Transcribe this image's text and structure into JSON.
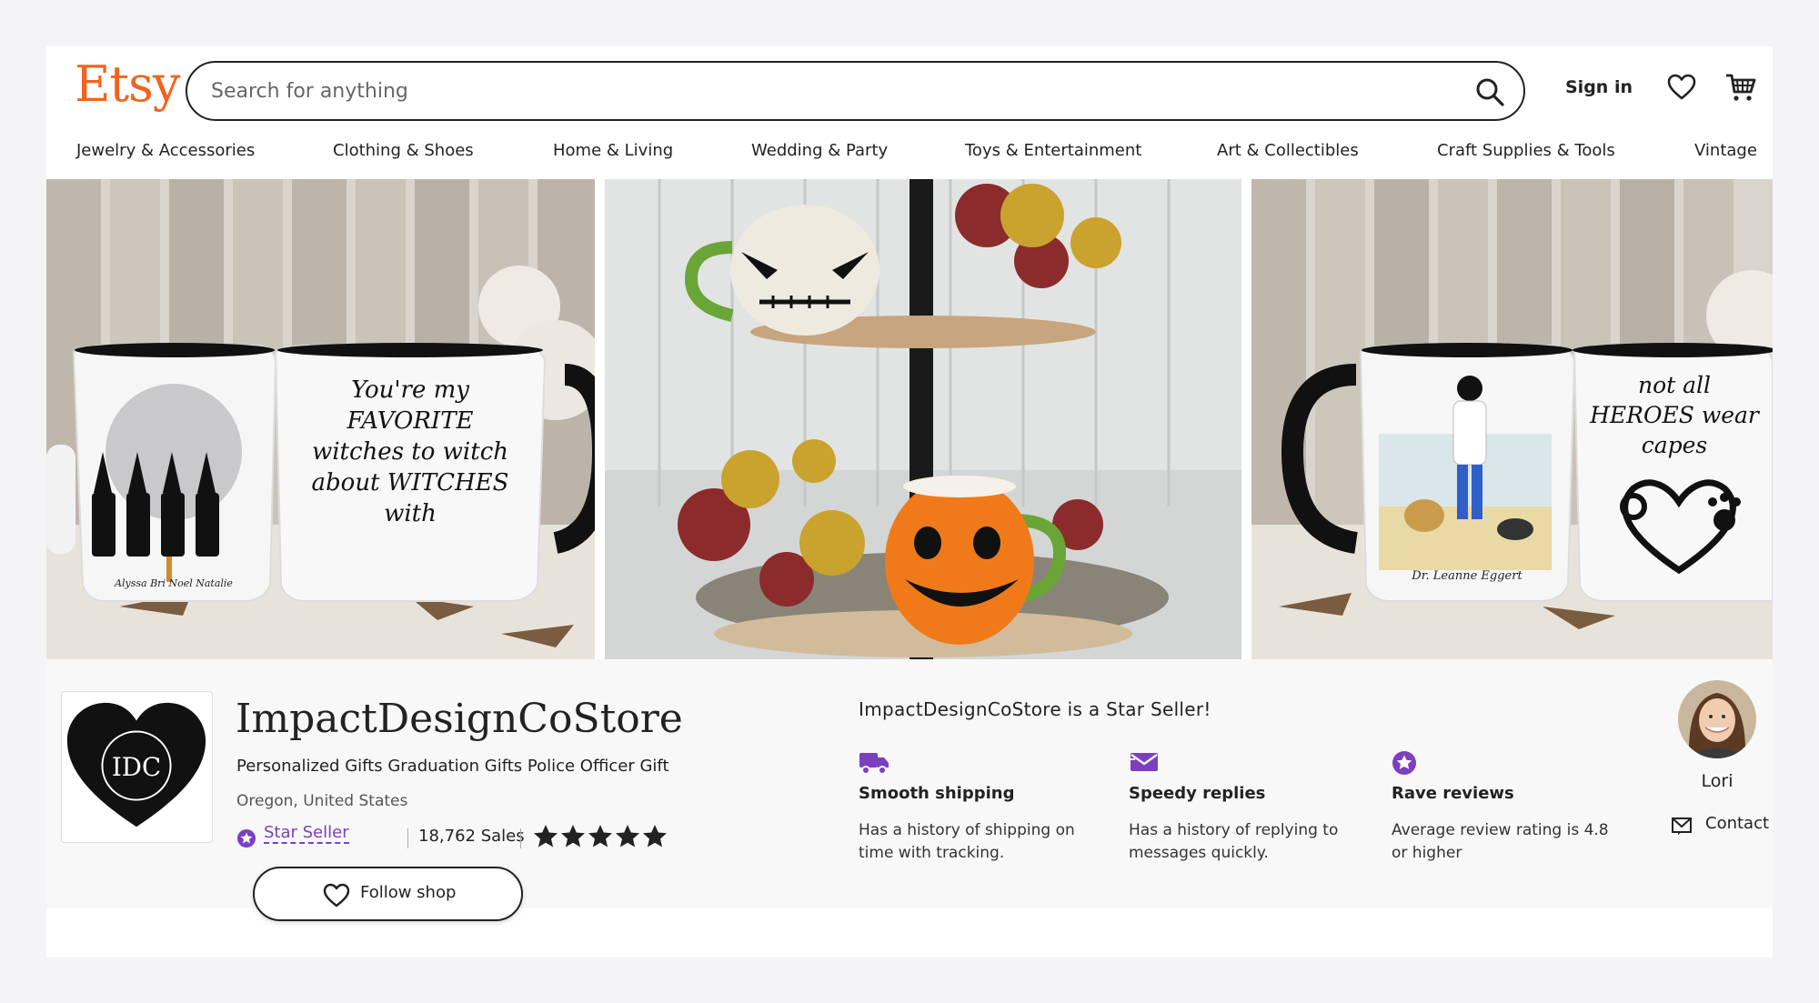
{
  "header": {
    "logo": "Etsy",
    "search_placeholder": "Search for anything",
    "sign_in": "Sign in"
  },
  "nav": [
    {
      "label": "Jewelry & Accessories"
    },
    {
      "label": "Clothing & Shoes"
    },
    {
      "label": "Home & Living"
    },
    {
      "label": "Wedding & Party"
    },
    {
      "label": "Toys & Entertainment"
    },
    {
      "label": "Art & Collectibles"
    },
    {
      "label": "Craft Supplies & Tools"
    },
    {
      "label": "Vintage"
    }
  ],
  "banner": {
    "left_mug_text": "You're my FAVORITE witches to witch about WITCHES with",
    "left_mug_names": "Alyssa  Bri  Noel  Natalie",
    "right_mug_text": "not all HEROES wear capes",
    "right_mug_name": "Dr. Leanne Eggert"
  },
  "shop": {
    "logo_initials": "IDC",
    "name": "ImpactDesignCoStore",
    "tagline": "Personalized Gifts Graduation Gifts Police Officer Gift",
    "location": "Oregon, United States",
    "star_seller_label": "Star Seller",
    "sales": "18,762 Sales",
    "rating": 5,
    "follow_label": "Follow shop"
  },
  "star_seller": {
    "title": "ImpactDesignCoStore is a Star Seller!",
    "features": [
      {
        "icon": "truck-icon",
        "title": "Smooth shipping",
        "desc": "Has a history of shipping on time with tracking."
      },
      {
        "icon": "message-icon",
        "title": "Speedy replies",
        "desc": "Has a history of replying to messages quickly."
      },
      {
        "icon": "star-badge-icon",
        "title": "Rave reviews",
        "desc": "Average review rating is 4.8 or higher"
      }
    ]
  },
  "owner": {
    "name": "Lori",
    "contact_label": "Contact"
  },
  "colors": {
    "brand": "#f1641e",
    "star_seller": "#7b3fbf",
    "text": "#222222"
  }
}
